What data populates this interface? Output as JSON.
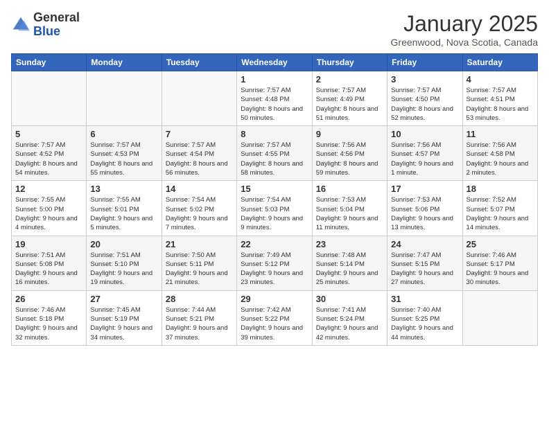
{
  "header": {
    "logo_general": "General",
    "logo_blue": "Blue",
    "month": "January 2025",
    "location": "Greenwood, Nova Scotia, Canada"
  },
  "weekdays": [
    "Sunday",
    "Monday",
    "Tuesday",
    "Wednesday",
    "Thursday",
    "Friday",
    "Saturday"
  ],
  "weeks": [
    [
      {
        "day": "",
        "sunrise": "",
        "sunset": "",
        "daylight": ""
      },
      {
        "day": "",
        "sunrise": "",
        "sunset": "",
        "daylight": ""
      },
      {
        "day": "",
        "sunrise": "",
        "sunset": "",
        "daylight": ""
      },
      {
        "day": "1",
        "sunrise": "Sunrise: 7:57 AM",
        "sunset": "Sunset: 4:48 PM",
        "daylight": "Daylight: 8 hours and 50 minutes."
      },
      {
        "day": "2",
        "sunrise": "Sunrise: 7:57 AM",
        "sunset": "Sunset: 4:49 PM",
        "daylight": "Daylight: 8 hours and 51 minutes."
      },
      {
        "day": "3",
        "sunrise": "Sunrise: 7:57 AM",
        "sunset": "Sunset: 4:50 PM",
        "daylight": "Daylight: 8 hours and 52 minutes."
      },
      {
        "day": "4",
        "sunrise": "Sunrise: 7:57 AM",
        "sunset": "Sunset: 4:51 PM",
        "daylight": "Daylight: 8 hours and 53 minutes."
      }
    ],
    [
      {
        "day": "5",
        "sunrise": "Sunrise: 7:57 AM",
        "sunset": "Sunset: 4:52 PM",
        "daylight": "Daylight: 8 hours and 54 minutes."
      },
      {
        "day": "6",
        "sunrise": "Sunrise: 7:57 AM",
        "sunset": "Sunset: 4:53 PM",
        "daylight": "Daylight: 8 hours and 55 minutes."
      },
      {
        "day": "7",
        "sunrise": "Sunrise: 7:57 AM",
        "sunset": "Sunset: 4:54 PM",
        "daylight": "Daylight: 8 hours and 56 minutes."
      },
      {
        "day": "8",
        "sunrise": "Sunrise: 7:57 AM",
        "sunset": "Sunset: 4:55 PM",
        "daylight": "Daylight: 8 hours and 58 minutes."
      },
      {
        "day": "9",
        "sunrise": "Sunrise: 7:56 AM",
        "sunset": "Sunset: 4:56 PM",
        "daylight": "Daylight: 8 hours and 59 minutes."
      },
      {
        "day": "10",
        "sunrise": "Sunrise: 7:56 AM",
        "sunset": "Sunset: 4:57 PM",
        "daylight": "Daylight: 9 hours and 1 minute."
      },
      {
        "day": "11",
        "sunrise": "Sunrise: 7:56 AM",
        "sunset": "Sunset: 4:58 PM",
        "daylight": "Daylight: 9 hours and 2 minutes."
      }
    ],
    [
      {
        "day": "12",
        "sunrise": "Sunrise: 7:55 AM",
        "sunset": "Sunset: 5:00 PM",
        "daylight": "Daylight: 9 hours and 4 minutes."
      },
      {
        "day": "13",
        "sunrise": "Sunrise: 7:55 AM",
        "sunset": "Sunset: 5:01 PM",
        "daylight": "Daylight: 9 hours and 5 minutes."
      },
      {
        "day": "14",
        "sunrise": "Sunrise: 7:54 AM",
        "sunset": "Sunset: 5:02 PM",
        "daylight": "Daylight: 9 hours and 7 minutes."
      },
      {
        "day": "15",
        "sunrise": "Sunrise: 7:54 AM",
        "sunset": "Sunset: 5:03 PM",
        "daylight": "Daylight: 9 hours and 9 minutes."
      },
      {
        "day": "16",
        "sunrise": "Sunrise: 7:53 AM",
        "sunset": "Sunset: 5:04 PM",
        "daylight": "Daylight: 9 hours and 11 minutes."
      },
      {
        "day": "17",
        "sunrise": "Sunrise: 7:53 AM",
        "sunset": "Sunset: 5:06 PM",
        "daylight": "Daylight: 9 hours and 13 minutes."
      },
      {
        "day": "18",
        "sunrise": "Sunrise: 7:52 AM",
        "sunset": "Sunset: 5:07 PM",
        "daylight": "Daylight: 9 hours and 14 minutes."
      }
    ],
    [
      {
        "day": "19",
        "sunrise": "Sunrise: 7:51 AM",
        "sunset": "Sunset: 5:08 PM",
        "daylight": "Daylight: 9 hours and 16 minutes."
      },
      {
        "day": "20",
        "sunrise": "Sunrise: 7:51 AM",
        "sunset": "Sunset: 5:10 PM",
        "daylight": "Daylight: 9 hours and 19 minutes."
      },
      {
        "day": "21",
        "sunrise": "Sunrise: 7:50 AM",
        "sunset": "Sunset: 5:11 PM",
        "daylight": "Daylight: 9 hours and 21 minutes."
      },
      {
        "day": "22",
        "sunrise": "Sunrise: 7:49 AM",
        "sunset": "Sunset: 5:12 PM",
        "daylight": "Daylight: 9 hours and 23 minutes."
      },
      {
        "day": "23",
        "sunrise": "Sunrise: 7:48 AM",
        "sunset": "Sunset: 5:14 PM",
        "daylight": "Daylight: 9 hours and 25 minutes."
      },
      {
        "day": "24",
        "sunrise": "Sunrise: 7:47 AM",
        "sunset": "Sunset: 5:15 PM",
        "daylight": "Daylight: 9 hours and 27 minutes."
      },
      {
        "day": "25",
        "sunrise": "Sunrise: 7:46 AM",
        "sunset": "Sunset: 5:17 PM",
        "daylight": "Daylight: 9 hours and 30 minutes."
      }
    ],
    [
      {
        "day": "26",
        "sunrise": "Sunrise: 7:46 AM",
        "sunset": "Sunset: 5:18 PM",
        "daylight": "Daylight: 9 hours and 32 minutes."
      },
      {
        "day": "27",
        "sunrise": "Sunrise: 7:45 AM",
        "sunset": "Sunset: 5:19 PM",
        "daylight": "Daylight: 9 hours and 34 minutes."
      },
      {
        "day": "28",
        "sunrise": "Sunrise: 7:44 AM",
        "sunset": "Sunset: 5:21 PM",
        "daylight": "Daylight: 9 hours and 37 minutes."
      },
      {
        "day": "29",
        "sunrise": "Sunrise: 7:42 AM",
        "sunset": "Sunset: 5:22 PM",
        "daylight": "Daylight: 9 hours and 39 minutes."
      },
      {
        "day": "30",
        "sunrise": "Sunrise: 7:41 AM",
        "sunset": "Sunset: 5:24 PM",
        "daylight": "Daylight: 9 hours and 42 minutes."
      },
      {
        "day": "31",
        "sunrise": "Sunrise: 7:40 AM",
        "sunset": "Sunset: 5:25 PM",
        "daylight": "Daylight: 9 hours and 44 minutes."
      },
      {
        "day": "",
        "sunrise": "",
        "sunset": "",
        "daylight": ""
      }
    ]
  ]
}
